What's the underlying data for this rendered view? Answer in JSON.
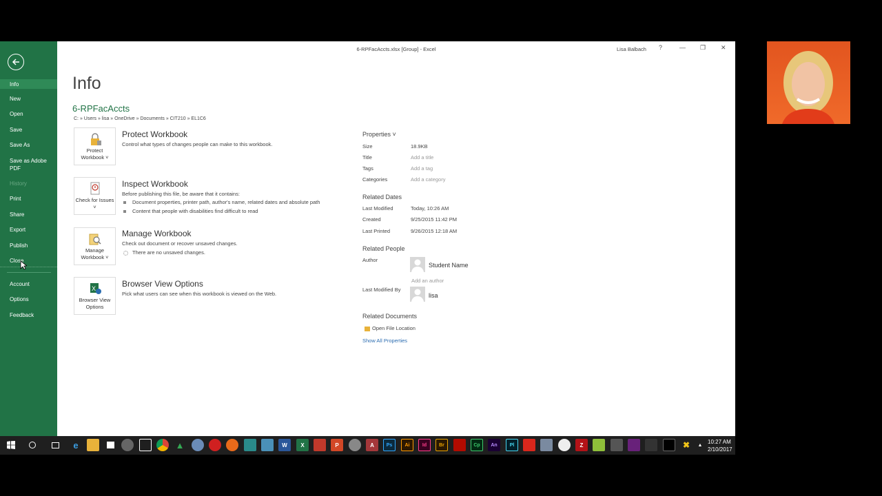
{
  "window": {
    "title": "6-RPFacAccts.xlsx  [Group] - Excel",
    "user": "Lisa Balbach",
    "help": "?"
  },
  "nav": {
    "items": [
      {
        "label": "Info",
        "active": true
      },
      {
        "label": "New"
      },
      {
        "label": "Open"
      },
      {
        "label": "Save"
      },
      {
        "label": "Save As"
      },
      {
        "label": "Save as Adobe PDF"
      },
      {
        "label": "History",
        "disabled": true
      },
      {
        "label": "Print"
      },
      {
        "label": "Share"
      },
      {
        "label": "Export"
      },
      {
        "label": "Publish"
      },
      {
        "label": "Close"
      },
      {
        "label": "Account"
      },
      {
        "label": "Options"
      },
      {
        "label": "Feedback"
      }
    ]
  },
  "info": {
    "title": "Info",
    "file_name": "6-RPFacAccts",
    "path": "C: » Users » lisa » OneDrive » Documents » CIT210 » EL1C6"
  },
  "cards": {
    "protect": {
      "button": "Protect Workbook ˅",
      "head": "Protect Workbook",
      "desc": "Control what types of changes people can make to this workbook."
    },
    "inspect": {
      "button": "Check for Issues ˅",
      "head": "Inspect Workbook",
      "desc": "Before publishing this file, be aware that it contains:",
      "bullets": [
        "Document properties, printer path, author's name, related dates and absolute path",
        "Content that people with disabilities find difficult to read"
      ]
    },
    "manage": {
      "button": "Manage Workbook ˅",
      "head": "Manage Workbook",
      "desc": "Check out document or recover unsaved changes.",
      "note": "There are no unsaved changes."
    },
    "browser": {
      "button": "Browser View Options",
      "head": "Browser View Options",
      "desc": "Pick what users can see when this workbook is viewed on the Web."
    }
  },
  "properties": {
    "head": "Properties ˅",
    "size_label": "Size",
    "size": "18.9KB",
    "title_label": "Title",
    "title": "Add a title",
    "tags_label": "Tags",
    "tags": "Add a tag",
    "categories_label": "Categories",
    "categories": "Add a category"
  },
  "dates": {
    "head": "Related Dates",
    "modified_label": "Last Modified",
    "modified": "Today, 10:26 AM",
    "created_label": "Created",
    "created": "9/25/2015 11:42 PM",
    "printed_label": "Last Printed",
    "printed": "9/26/2015 12:18 AM"
  },
  "people": {
    "head": "Related People",
    "author_label": "Author",
    "author": "Student Name",
    "add_author": "Add an author",
    "modified_by_label": "Last Modified By",
    "modified_by": "lisa"
  },
  "documents": {
    "head": "Related Documents",
    "open_location": "Open File Location",
    "show_all": "Show All Properties"
  },
  "taskbar": {
    "time": "10:27 AM",
    "date": "2/10/2017"
  },
  "colors": {
    "excel_green": "#217346",
    "taskbar": "#1f1f1f"
  }
}
